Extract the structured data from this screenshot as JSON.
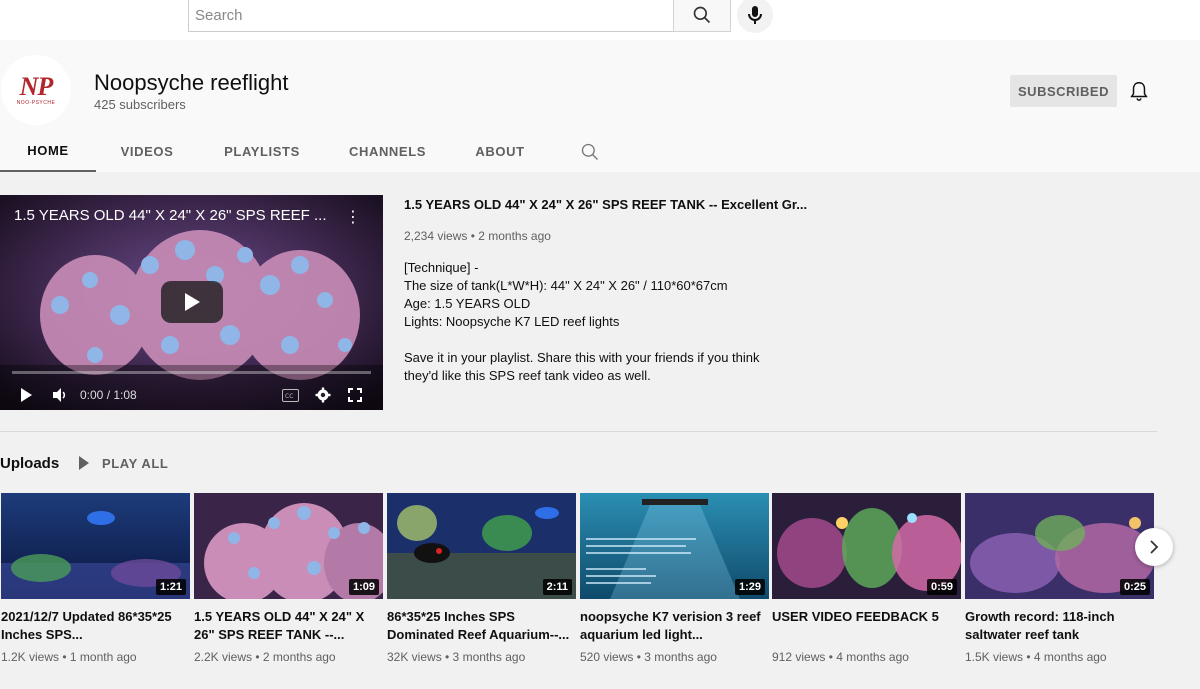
{
  "search": {
    "placeholder": "Search"
  },
  "channel": {
    "avatar_mark": "NP",
    "avatar_sub": "NOO-PSYCHE",
    "name": "Noopsyche reeflight",
    "subscribers": "425 subscribers",
    "subscribe_label": "SUBSCRIBED"
  },
  "tabs": [
    {
      "label": "HOME"
    },
    {
      "label": "VIDEOS"
    },
    {
      "label": "PLAYLISTS"
    },
    {
      "label": "CHANNELS"
    },
    {
      "label": "ABOUT"
    }
  ],
  "featured": {
    "player_title": "1.5 YEARS OLD 44\" X 24\" X 26\" SPS REEF ...",
    "time": "0:00 / 1:08",
    "title": "1.5 YEARS OLD 44\" X 24\" X 26\" SPS REEF TANK -- Excellent Gr...",
    "meta": "2,234 views • 2 months ago",
    "desc_lines": [
      "[Technique] -",
      "The size of tank(L*W*H): 44\" X 24\" X 26\" / 110*60*67cm",
      "Age: 1.5 YEARS OLD",
      "Lights: Noopsyche K7 LED reef lights"
    ],
    "desc_para2": "Save it in your playlist. Share this with your friends if you think they'd like this SPS reef tank video as well."
  },
  "uploads": {
    "title": "Uploads",
    "play_all": "PLAY ALL",
    "videos": [
      {
        "title": "2021/12/7 Updated 86*35*25 Inches SPS...",
        "meta": "1.2K views • 1 month ago",
        "duration": "1:21"
      },
      {
        "title": "1.5 YEARS OLD 44\" X 24\" X 26\" SPS REEF TANK --...",
        "meta": "2.2K views • 2 months ago",
        "duration": "1:09"
      },
      {
        "title": "86*35*25 Inches SPS Dominated Reef Aquarium--...",
        "meta": "32K views • 3 months ago",
        "duration": "2:11"
      },
      {
        "title": "noopsyche K7 verision 3 reef aquarium led light...",
        "meta": "520 views • 3 months ago",
        "duration": "1:29"
      },
      {
        "title": "USER VIDEO FEEDBACK 5",
        "meta": "912 views • 4 months ago",
        "duration": "0:59"
      },
      {
        "title": "Growth record: 118-inch saltwater reef tank",
        "meta": "1.5K views • 4 months ago",
        "duration": "0:25"
      }
    ]
  }
}
